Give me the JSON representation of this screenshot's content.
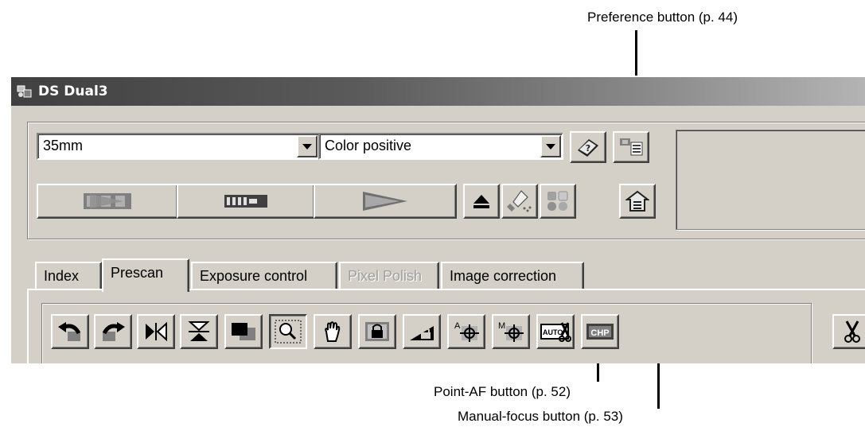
{
  "callouts": {
    "preference": "Preference button (p. 44)",
    "point_af": "Point-AF button (p. 52)",
    "manual_focus": "Manual-focus button (p. 53)"
  },
  "window": {
    "title": "DS Dual3"
  },
  "toolbar": {
    "film_format": "35mm",
    "film_type": "Color positive"
  },
  "tabs": [
    {
      "label": "Index",
      "state": "normal"
    },
    {
      "label": "Prescan",
      "state": "active"
    },
    {
      "label": "Exposure control",
      "state": "normal"
    },
    {
      "label": "Pixel Polish",
      "state": "disabled"
    },
    {
      "label": "Image correction",
      "state": "normal"
    }
  ],
  "tools": {
    "autofocus_label": "AUTO",
    "chip_label": "CHP",
    "point_af_letter": "A",
    "manual_focus_letter": "M"
  },
  "icons": [
    "help-book-icon",
    "frame-settings-icon",
    "scan-icon",
    "index-scan-icon",
    "prescan-icon",
    "eject-icon",
    "brush-icon",
    "color-match-icon",
    "preference-icon",
    "rotate-left-icon",
    "rotate-right-icon",
    "flip-horizontal-icon",
    "flip-vertical-icon",
    "frame-toggle-icon",
    "zoom-icon",
    "hand-icon",
    "lock-icon",
    "lock-exposure-icon",
    "point-af-icon",
    "manual-focus-icon",
    "auto-crop-icon",
    "chip-icon",
    "crop-icon"
  ],
  "colors": {
    "window_face": "#d4d0c8",
    "title_start": "#404040",
    "title_end": "#b4b4b4",
    "disabled_text": "#a0a0a0"
  }
}
